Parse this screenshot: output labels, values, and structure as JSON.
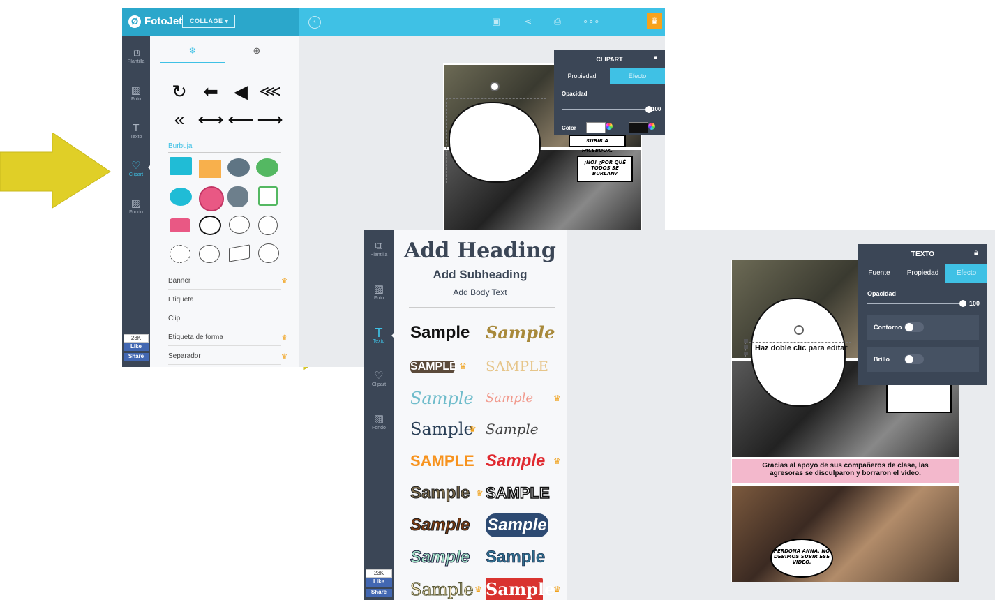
{
  "app": {
    "logo_text": "FotoJet",
    "logo_glyph": "Ø",
    "mode_label": "COLLAGE ▾"
  },
  "screen1": {
    "nav": [
      {
        "label": "Plantilla",
        "icon": "template-icon"
      },
      {
        "label": "Foto",
        "icon": "photo-icon"
      },
      {
        "label": "Texto",
        "icon": "text-icon"
      },
      {
        "label": "Clipart",
        "icon": "heart-icon"
      },
      {
        "label": "Fondo",
        "icon": "background-icon"
      }
    ],
    "section_bubble": "Burbuja",
    "list": [
      {
        "label": "Banner",
        "premium": true
      },
      {
        "label": "Etiqueta",
        "premium": false
      },
      {
        "label": "Clip",
        "premium": false
      },
      {
        "label": "Etiqueta de forma",
        "premium": true
      },
      {
        "label": "Separador",
        "premium": true
      }
    ],
    "fb_count": "23K",
    "fb_like": "Like",
    "fb_share": "Share",
    "props": {
      "title": "CLIPART",
      "tab_prop": "Propiedad",
      "tab_effect": "Efecto",
      "opacity_label": "Opacidad",
      "opacity_value": "100",
      "opacity_fraction": 1.0,
      "color_label": "Color"
    },
    "comic": {
      "bubble_top": "SUBIR A FACEBOOK.",
      "bubble_right": "¡NO! ¿POR QUÉ TODOS SE BURLAN?"
    }
  },
  "screen2": {
    "nav": [
      {
        "label": "Plantilla"
      },
      {
        "label": "Foto"
      },
      {
        "label": "Texto"
      },
      {
        "label": "Clipart"
      },
      {
        "label": "Fondo"
      }
    ],
    "heading": "Add Heading",
    "subheading": "Add Subheading",
    "body_text": "Add Body Text",
    "samples": [
      {
        "text": "Sample",
        "premium": false
      },
      {
        "text": "Sample",
        "premium": false
      },
      {
        "text": "SAMPLE",
        "premium": true
      },
      {
        "text": "SAMPLE",
        "premium": false
      },
      {
        "text": "Sample",
        "premium": false
      },
      {
        "text": "Sample",
        "premium": true
      },
      {
        "text": "Sample",
        "premium": true
      },
      {
        "text": "Sample",
        "premium": false
      },
      {
        "text": "SAMPLE",
        "premium": false
      },
      {
        "text": "Sample",
        "premium": true
      },
      {
        "text": "Sample",
        "premium": true
      },
      {
        "text": "SAMPLE",
        "premium": false
      },
      {
        "text": "Sample",
        "premium": false
      },
      {
        "text": "Sample",
        "premium": false
      },
      {
        "text": "Sample",
        "premium": false
      },
      {
        "text": "Sample",
        "premium": false
      },
      {
        "text": "Sample",
        "premium": true
      },
      {
        "text": "Sample",
        "premium": true
      }
    ],
    "fb_count": "23K",
    "fb_like": "Like",
    "fb_share": "Share",
    "props": {
      "title": "TEXTO",
      "tab_font": "Fuente",
      "tab_prop": "Propiedad",
      "tab_effect": "Efecto",
      "opacity_label": "Opacidad",
      "opacity_value": "100",
      "opacity_fraction": 1.0,
      "outline_label": "Contorno",
      "glow_label": "Brillo"
    },
    "edit_text": "Haz doble clic para editar",
    "banner": "Gracias al apoyo de sus compañeros de clase, las agresoras se disculparon y borraron el vídeo.",
    "bubble_bottom": "PERDONA ANNA, NO DEBIMOS SUBIR ESE VIDEO."
  },
  "colors": {
    "accent": "#3fc1e5",
    "nav_bg": "#3b4656",
    "premium": "#f0a11b",
    "arrow": "#e0cf27"
  }
}
